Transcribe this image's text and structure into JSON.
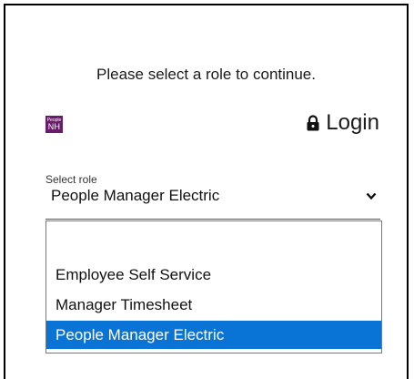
{
  "prompt": "Please select a role to continue.",
  "logo": {
    "line1": "People",
    "line2": "NH",
    "color": "#6a1b6b",
    "icon": "company-logo"
  },
  "login": {
    "label": "Login",
    "icon": "lock-icon"
  },
  "role_select": {
    "caption": "Select role",
    "value": "People Manager Electric",
    "icon": "chevron-down-icon"
  },
  "dropdown": {
    "options": [
      {
        "label": ""
      },
      {
        "label": "Employee Self Service"
      },
      {
        "label": "Manager Timesheet"
      },
      {
        "label": "People Manager Electric",
        "selected": true
      }
    ],
    "highlight_color": "#0a74d6"
  }
}
